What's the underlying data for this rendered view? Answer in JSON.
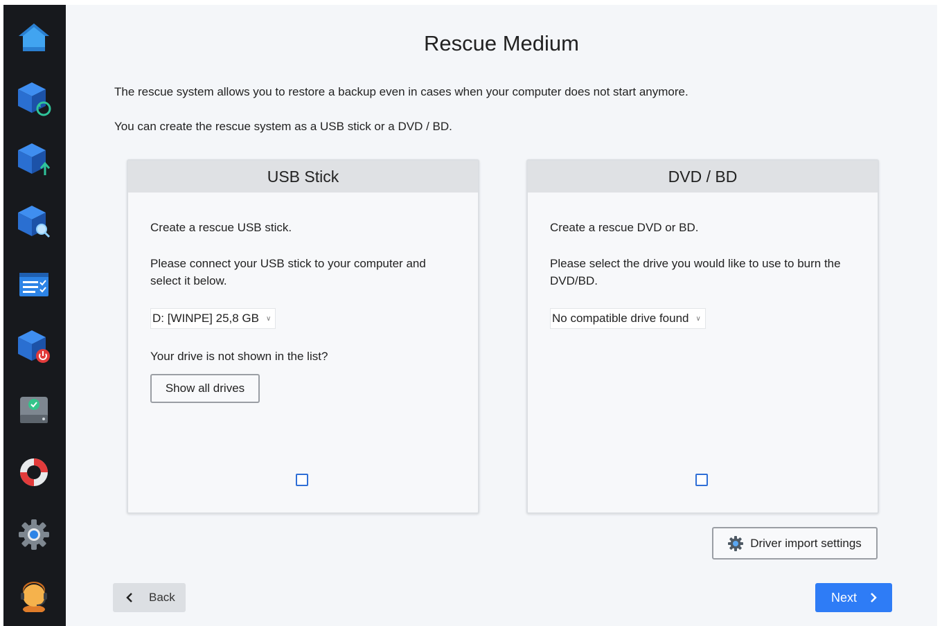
{
  "page": {
    "title": "Rescue Medium"
  },
  "description": {
    "line1": "The rescue system allows you to restore a backup even in cases when your computer does not start anymore.",
    "line2": "You can create the rescue system as a USB stick or a DVD / BD."
  },
  "usb_card": {
    "header": "USB Stick",
    "intro": "Create a rescue USB stick.",
    "instruction": "Please connect your USB stick to your computer and select it below.",
    "drive_select": {
      "value": "D: [WINPE] 25,8 GB"
    },
    "not_listed": "Your drive is not shown in the list?",
    "show_all_label": "Show all drives",
    "checkbox_checked": false
  },
  "dvd_card": {
    "header": "DVD / BD",
    "intro": "Create a rescue DVD or BD.",
    "instruction": "Please select the drive you would like to use to burn the DVD/BD.",
    "drive_select": {
      "value": "No compatible drive found"
    },
    "checkbox_checked": false
  },
  "driver_import_label": "Driver import settings",
  "nav": {
    "back_label": "Back",
    "next_label": "Next"
  },
  "sidebar": {
    "items": [
      {
        "icon": "home-icon"
      },
      {
        "icon": "backup-restore-icon"
      },
      {
        "icon": "backup-upload-icon"
      },
      {
        "icon": "backup-search-icon"
      },
      {
        "icon": "task-list-icon"
      },
      {
        "icon": "backup-shutdown-icon"
      },
      {
        "icon": "drive-check-icon"
      },
      {
        "icon": "lifebuoy-icon"
      },
      {
        "icon": "settings-gear-icon"
      },
      {
        "icon": "support-agent-icon"
      }
    ]
  },
  "colors": {
    "accent": "#2e7cf6",
    "sidebar_bg": "#17191d",
    "page_bg": "#f4f6f9",
    "card_header_bg": "#dfe1e4"
  }
}
